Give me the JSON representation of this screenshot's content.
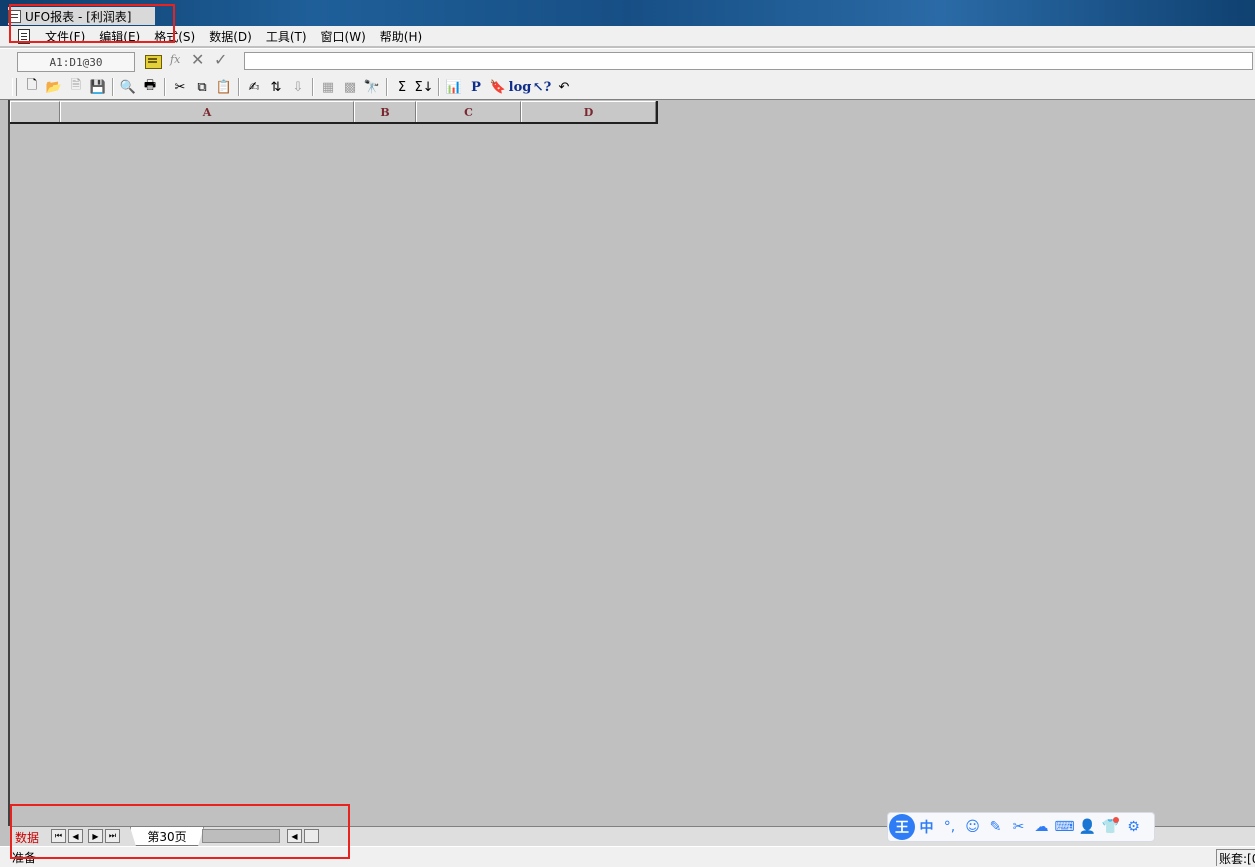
{
  "window": {
    "title": "UFO报表 - [利润表]"
  },
  "menubar": {
    "items": [
      "文件(F)",
      "编辑(E)",
      "格式(S)",
      "数据(D)",
      "工具(T)",
      "窗口(W)",
      "帮助(H)"
    ]
  },
  "formulabar": {
    "cell_ref": "A1:D1@30",
    "formula": ""
  },
  "toolbar": {
    "buttons": [
      {
        "name": "new-file-icon",
        "glyph": "🗋"
      },
      {
        "name": "open-folder-icon",
        "glyph": "📂"
      },
      {
        "name": "document-icon",
        "glyph": "🗎",
        "disabled": true
      },
      {
        "name": "save-icon",
        "glyph": "💾"
      },
      {
        "name": "print-preview-icon",
        "glyph": "🔍"
      },
      {
        "name": "print-icon",
        "glyph": "🖶"
      },
      {
        "name": "cut-icon",
        "glyph": "✂"
      },
      {
        "name": "copy-icon",
        "glyph": "⧉"
      },
      {
        "name": "paste-icon",
        "glyph": "📋",
        "disabled": true
      },
      {
        "name": "format-painter-icon",
        "glyph": "✍"
      },
      {
        "name": "sort-ascending-icon",
        "glyph": "⇅"
      },
      {
        "name": "sort-descending-icon",
        "glyph": "⇩",
        "disabled": true
      },
      {
        "name": "insert-table-icon",
        "glyph": "▦",
        "disabled": true
      },
      {
        "name": "grid-icon",
        "glyph": "▩",
        "disabled": true
      },
      {
        "name": "find-icon",
        "glyph": "🔭",
        "disabled": true
      },
      {
        "name": "sum-icon",
        "glyph": "Σ"
      },
      {
        "name": "sum-down-icon",
        "glyph": "Σ↓"
      },
      {
        "name": "chart-icon",
        "glyph": "📊"
      },
      {
        "name": "p-icon",
        "text": "P"
      },
      {
        "name": "bookmark-icon",
        "glyph": "🔖"
      },
      {
        "name": "log-icon",
        "text": "log"
      },
      {
        "name": "help-pointer-icon",
        "text": "↖?"
      },
      {
        "name": "undo-icon",
        "glyph": "↶"
      }
    ]
  },
  "grid": {
    "columns": [
      {
        "label": "A"
      },
      {
        "label": "B"
      },
      {
        "label": "C"
      },
      {
        "label": "D"
      }
    ]
  },
  "sheetbar": {
    "mode_label": "数据",
    "tab_label": "第30页"
  },
  "ime": {
    "logo": "王",
    "buttons": [
      {
        "name": "ime-chinese-icon",
        "text": "中"
      },
      {
        "name": "ime-punctuation-icon",
        "text": "°,"
      },
      {
        "name": "ime-emoji-icon",
        "text": "☺"
      },
      {
        "name": "ime-handwriting-icon",
        "text": "✎"
      },
      {
        "name": "ime-screenshot-icon",
        "text": "✂"
      },
      {
        "name": "ime-cloud-icon",
        "text": "☁"
      },
      {
        "name": "ime-keyboard-icon",
        "text": "⌨"
      },
      {
        "name": "ime-user-icon",
        "text": "👤"
      },
      {
        "name": "ime-skin-icon",
        "text": "👕"
      },
      {
        "name": "ime-settings-icon",
        "text": "⚙"
      }
    ]
  },
  "statusbar": {
    "text": "准备",
    "account": "账套:[0"
  }
}
